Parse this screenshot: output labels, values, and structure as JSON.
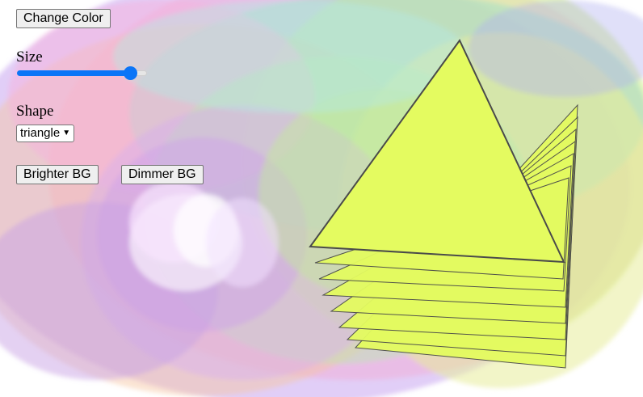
{
  "controls": {
    "change_color_label": "Change Color",
    "size_label": "Size",
    "size_value": 0.87,
    "shape_label": "Shape",
    "shape_selected": "triangle",
    "brighter_bg_label": "Brighter BG",
    "dimmer_bg_label": "Dimmer BG"
  },
  "theme": {
    "slider_color": "#0b75f7",
    "triangle_fill": "#e4fb60",
    "triangle_stroke": "#4a4a4a"
  }
}
